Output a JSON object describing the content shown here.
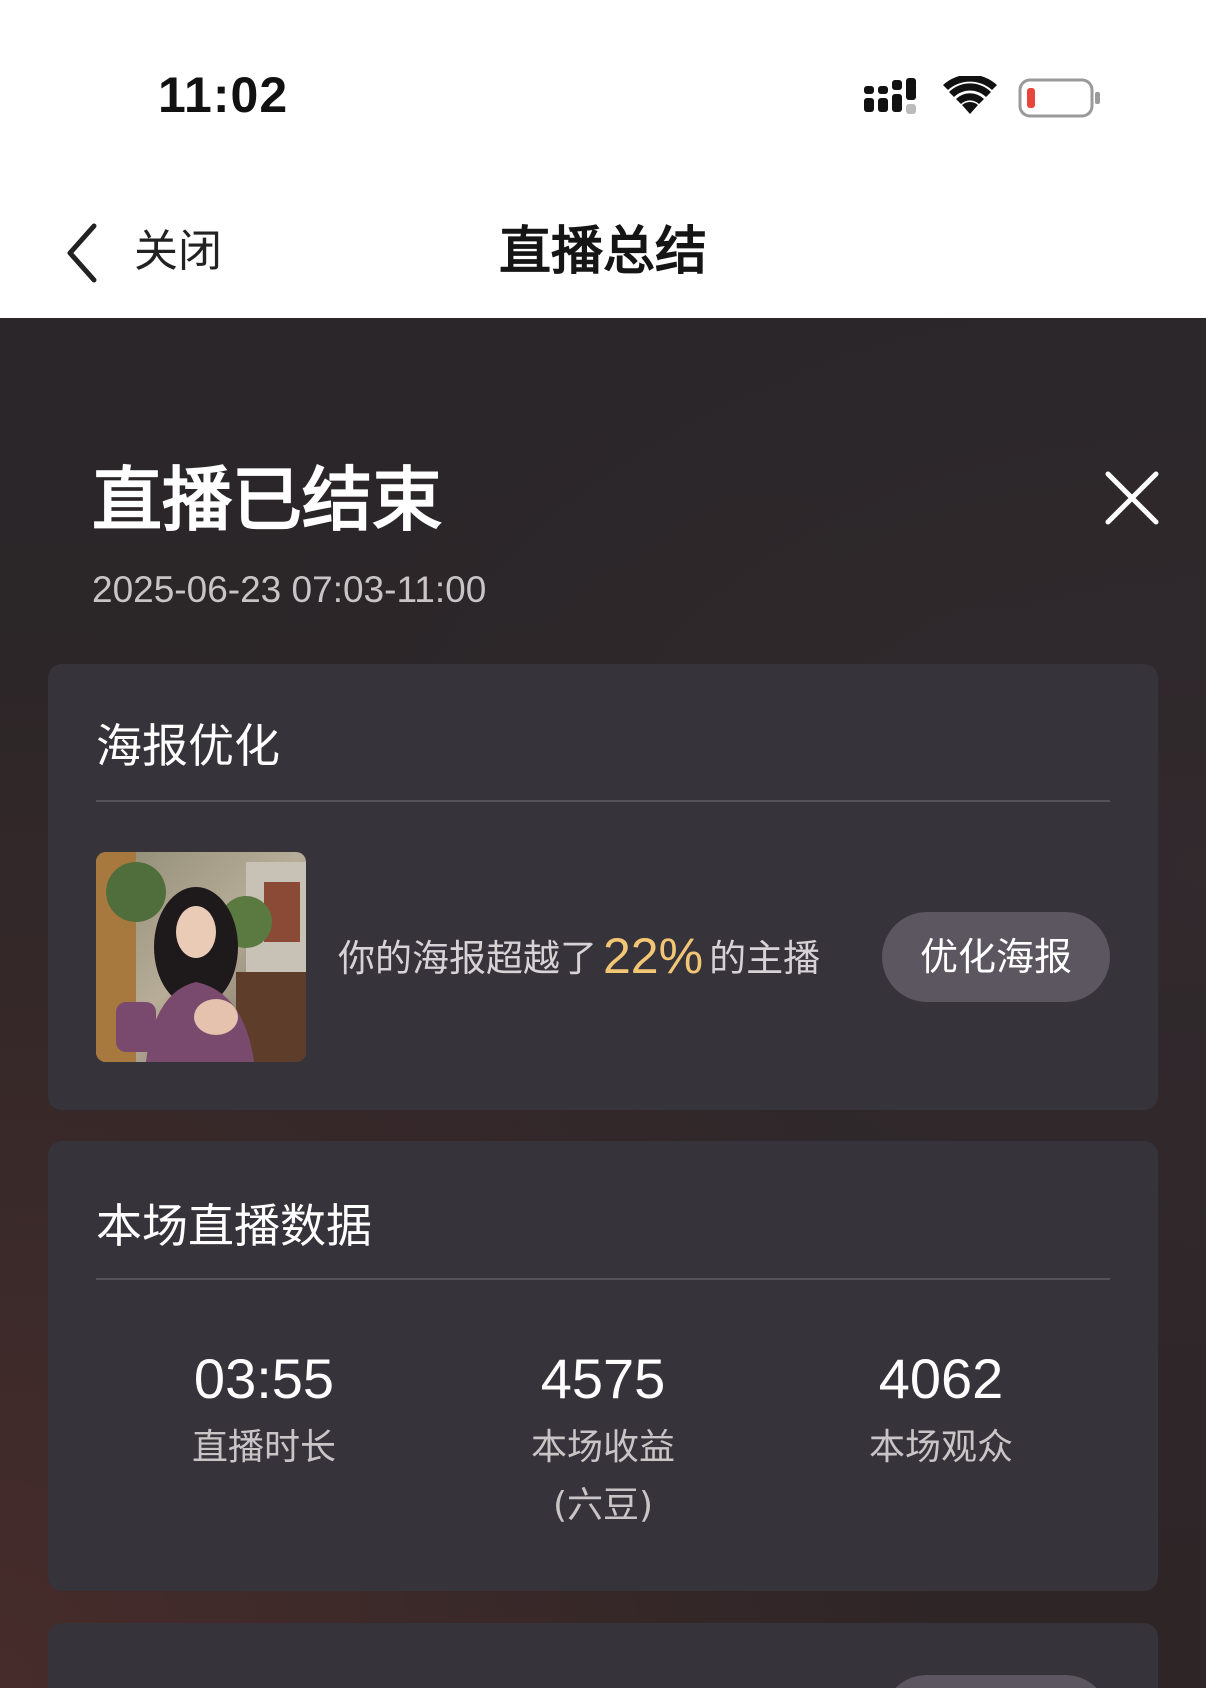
{
  "status_bar": {
    "time": "11:02",
    "icons": [
      "signal-icon",
      "wifi-icon",
      "battery-low-icon"
    ],
    "battery_color": "#e8463c"
  },
  "nav": {
    "back_label": "关闭",
    "title": "直播总结"
  },
  "summary": {
    "title": "直播已结束",
    "time_range": "2025-06-23 07:03-11:00"
  },
  "poster_card": {
    "heading": "海报优化",
    "text_before": "你的海报超越了",
    "percent": "22%",
    "text_after": "的主播",
    "button_label": "优化海报",
    "accent_color": "#f3c676"
  },
  "stats_card": {
    "heading": "本场直播数据",
    "stats": [
      {
        "value": "03:55",
        "label": "直播时长"
      },
      {
        "value": "4575",
        "label": "本场收益\n(六豆)"
      },
      {
        "value": "4062",
        "label": "本场观众"
      }
    ]
  },
  "colors": {
    "card_bg": "#37333a",
    "page_bg": "#2a2629",
    "button_bg": "#5c5660"
  }
}
